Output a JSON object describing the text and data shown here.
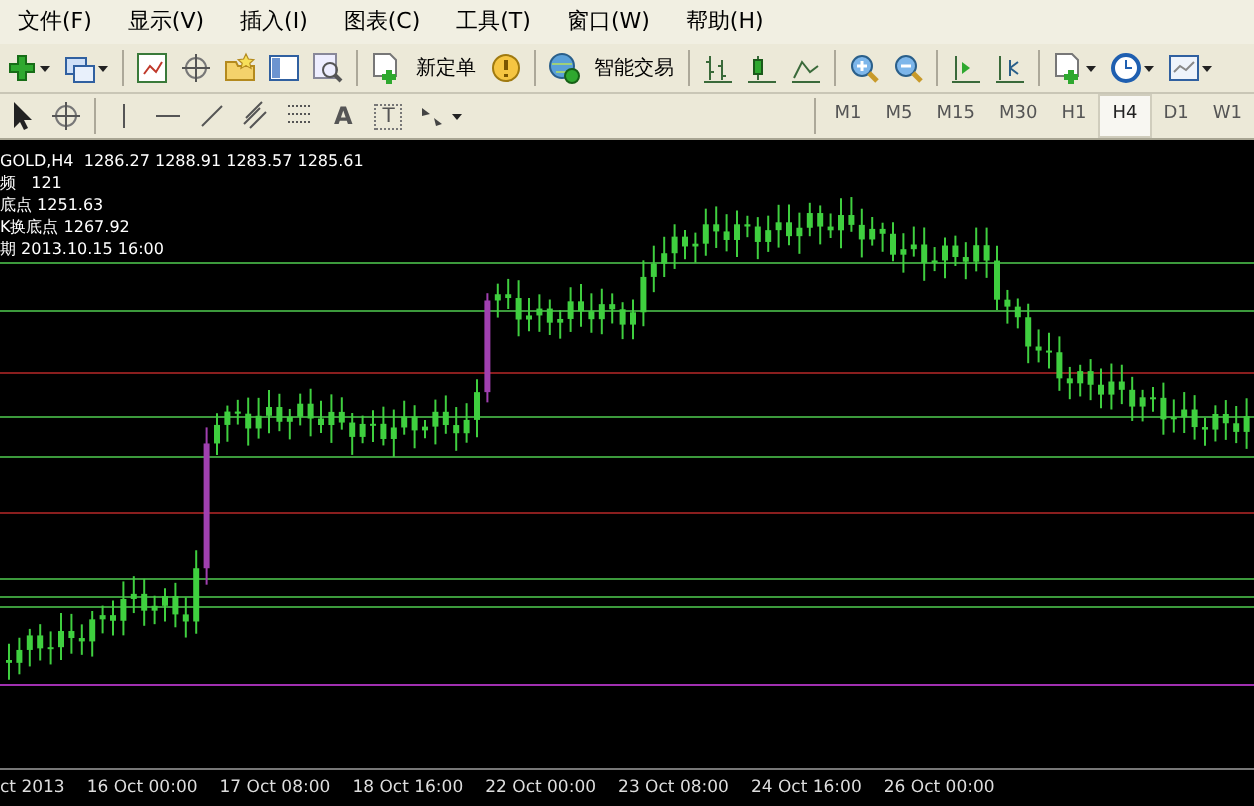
{
  "menu": [
    {
      "label": "文件(F)"
    },
    {
      "label": "显示(V)"
    },
    {
      "label": "插入(I)"
    },
    {
      "label": "图表(C)"
    },
    {
      "label": "工具(T)"
    },
    {
      "label": "窗口(W)"
    },
    {
      "label": "帮助(H)"
    }
  ],
  "toolbar": {
    "new_order": "新定单",
    "expert_advisors": "智能交易"
  },
  "drawing_tools": {
    "text_tool": "A",
    "label_tool": "T"
  },
  "timeframes": [
    {
      "label": "M1",
      "selected": false
    },
    {
      "label": "M5",
      "selected": false
    },
    {
      "label": "M15",
      "selected": false
    },
    {
      "label": "M30",
      "selected": false
    },
    {
      "label": "H1",
      "selected": false
    },
    {
      "label": "H4",
      "selected": true
    },
    {
      "label": "D1",
      "selected": false
    },
    {
      "label": "W1",
      "selected": false
    }
  ],
  "chart": {
    "header": "GOLD,H4  1286.27 1288.91 1283.57 1285.61",
    "info_lines": [
      "频   121",
      "底点 1251.63",
      "K换底点 1267.92",
      "期 2013.10.15 16:00"
    ],
    "time_axis": [
      "ct 2013",
      "16 Oct 00:00",
      "17 Oct 08:00",
      "18 Oct 16:00",
      "22 Oct 00:00",
      "23 Oct 08:00",
      "24 Oct 16:00",
      "26 Oct 00:00"
    ]
  }
}
